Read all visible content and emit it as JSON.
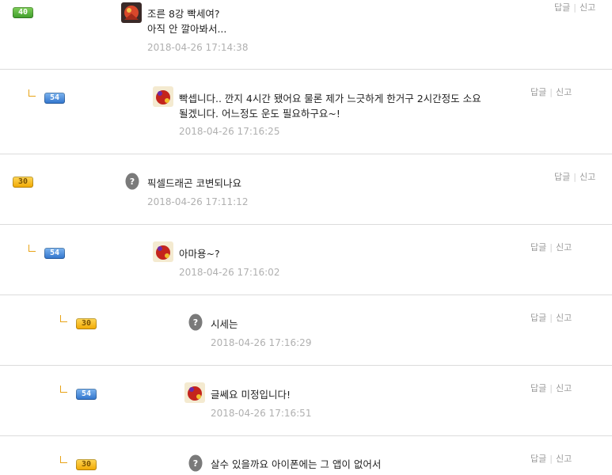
{
  "comments": [
    {
      "level": "40",
      "text_line1_a": "조른 8강 빡세여?",
      "text_line2": "아직 안 깔아봐서...",
      "date": "2018-04-26 17:14:38",
      "reply_label": "답글",
      "report_label": "신고"
    },
    {
      "level": "54",
      "text_line1": "빡셉니다.. 깐지 4시간 됐어요 물론 제가 느긋하게 한거구 2시간정도 소요",
      "text_line2": "될겠니다. 어느정도 운도 필요하구요~!",
      "date": "2018-04-26 17:16:25",
      "reply_label": "답글",
      "report_label": "신고"
    },
    {
      "level": "30",
      "text_line1": "픽셀드래곤 코변되나요",
      "date": "2018-04-26 17:11:12",
      "reply_label": "답글",
      "report_label": "신고"
    },
    {
      "level": "54",
      "text_line1": "아마용~?",
      "date": "2018-04-26 17:16:02",
      "reply_label": "답글",
      "report_label": "신고"
    },
    {
      "level": "30",
      "text_line1": "시세는",
      "date": "2018-04-26 17:16:29",
      "reply_label": "답글",
      "report_label": "신고"
    },
    {
      "level": "54",
      "text_line1": "글쎄요 미정입니다!",
      "date": "2018-04-26 17:16:51",
      "reply_label": "답글",
      "report_label": "신고"
    },
    {
      "level": "30",
      "text_line1": "살수 있을까요 아이폰에는 그 앱이 없어서",
      "reply_label": "답글",
      "report_label": "신고"
    }
  ],
  "colors": {
    "level_green": "#3f9d2b",
    "level_blue": "#2f73cc",
    "level_yellow": "#f0a800",
    "reply_arrow": "#e8a317",
    "date_text": "#b0b0b0"
  }
}
